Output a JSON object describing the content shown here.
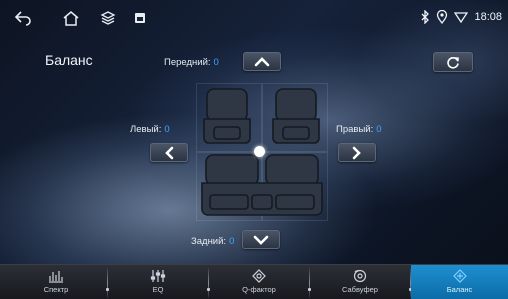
{
  "status_bar": {
    "time": "18:08",
    "icons": [
      "back-icon",
      "home-icon",
      "layers-icon",
      "gallery-icon",
      "bluetooth-icon",
      "location-icon",
      "wifi-icon"
    ]
  },
  "screen": {
    "title": "Баланс",
    "front_label": "Передний:",
    "front_value": "0",
    "rear_label": "Задний:",
    "rear_value": "0",
    "left_label": "Левый:",
    "left_value": "0",
    "right_label": "Правый:",
    "right_value": "0"
  },
  "tabs": [
    {
      "label": "Спектр",
      "icon": "spectrum-icon",
      "active": false
    },
    {
      "label": "EQ",
      "icon": "equalizer-icon",
      "active": false
    },
    {
      "label": "Q-фактор",
      "icon": "q-factor-icon",
      "active": false
    },
    {
      "label": "Сабвуфер",
      "icon": "subwoofer-icon",
      "active": false
    },
    {
      "label": "Баланс",
      "icon": "balance-icon",
      "active": true
    }
  ],
  "colors": {
    "accent": "#39a7ff",
    "active_tab": "#1480c4"
  }
}
